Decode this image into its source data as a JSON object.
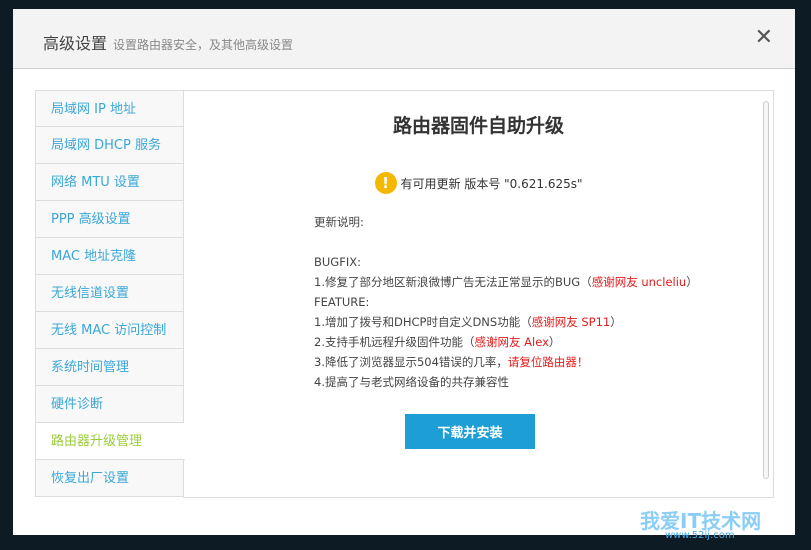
{
  "header": {
    "title": "高级设置",
    "subtitle": "设置路由器安全，及其他高级设置",
    "close": "✕"
  },
  "sidebar": {
    "items": [
      {
        "label": "局域网 IP 地址"
      },
      {
        "label": "局域网 DHCP 服务"
      },
      {
        "label": "网络 MTU 设置"
      },
      {
        "label": "PPP 高级设置"
      },
      {
        "label": "MAC 地址克隆"
      },
      {
        "label": "无线信道设置"
      },
      {
        "label": "无线 MAC 访问控制"
      },
      {
        "label": "系统时间管理"
      },
      {
        "label": "硬件诊断"
      },
      {
        "label": "路由器升级管理"
      },
      {
        "label": "恢复出厂设置"
      }
    ],
    "active_index": 9
  },
  "main": {
    "title": "路由器固件自助升级",
    "update_available": "有可用更新 版本号 \"0.621.625s\"",
    "notes_label": "更新说明:",
    "bugfix": "BUGFIX:",
    "fix1": "1.修复了部分地区新浪微博广告无法正常显示的BUG（",
    "fix1_thanks": "感谢网友 uncleliu",
    "close_paren": "）",
    "feature": "FEATURE:",
    "f1": "1.增加了拨号和DHCP时自定义DNS功能（",
    "f1_thanks": "感谢网友 SP11",
    "f2": "2.支持手机远程升级固件功能（",
    "f2_thanks": "感谢网友 Alex",
    "f3": "3.降低了浏览器显示504错误的几率，",
    "f3_red": "请复位路由器！",
    "f4": "4.提高了与老式网络设备的共存兼容性",
    "button": "下载并安装"
  },
  "watermark": {
    "text": "我爱IT技术网",
    "url": "www.52ij.com"
  }
}
